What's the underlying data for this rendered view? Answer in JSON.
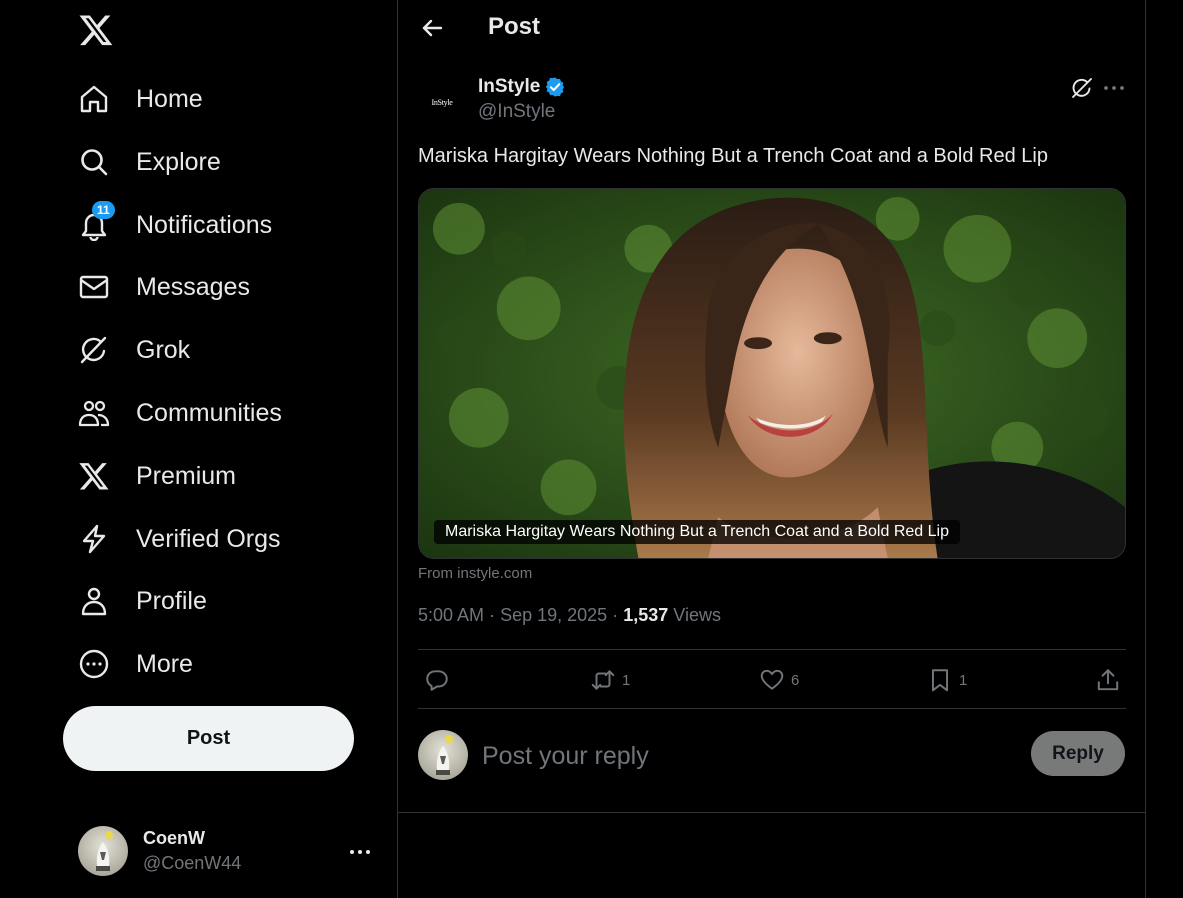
{
  "sidebar": {
    "logo": "x-logo-icon",
    "items": [
      {
        "label": "Home",
        "icon": "home-icon"
      },
      {
        "label": "Explore",
        "icon": "search-icon"
      },
      {
        "label": "Notifications",
        "icon": "bell-icon",
        "badge": "11"
      },
      {
        "label": "Messages",
        "icon": "envelope-icon"
      },
      {
        "label": "Grok",
        "icon": "grok-icon"
      },
      {
        "label": "Communities",
        "icon": "people-icon"
      },
      {
        "label": "Premium",
        "icon": "x-logo-icon"
      },
      {
        "label": "Verified Orgs",
        "icon": "lightning-icon"
      },
      {
        "label": "Profile",
        "icon": "person-icon"
      },
      {
        "label": "More",
        "icon": "more-circle-icon"
      }
    ],
    "post_button": "Post",
    "account": {
      "name": "CoenW",
      "handle": "@CoenW44"
    }
  },
  "header": {
    "title": "Post"
  },
  "post": {
    "author": {
      "name": "InStyle",
      "handle": "@InStyle",
      "avatar_text": "InStyle",
      "verified": true
    },
    "text": "Mariska Hargitay Wears Nothing But a Trench Coat and a Bold Red Lip",
    "card": {
      "caption": "Mariska Hargitay Wears Nothing But a Trench Coat and a Bold Red Lip",
      "source": "From instyle.com"
    },
    "meta": {
      "time": "5:00 AM",
      "separator": "·",
      "date": "Sep 19, 2025",
      "views_count": "1,537",
      "views_label": "Views"
    },
    "actions": {
      "reply_count": "",
      "repost_count": "1",
      "like_count": "6",
      "bookmark_count": "1"
    }
  },
  "reply": {
    "placeholder": "Post your reply",
    "button": "Reply"
  },
  "colors": {
    "accent": "#1d9bf0",
    "background": "#000000",
    "text": "#e7e9ea",
    "muted": "#71767b",
    "border": "#2f3336"
  }
}
